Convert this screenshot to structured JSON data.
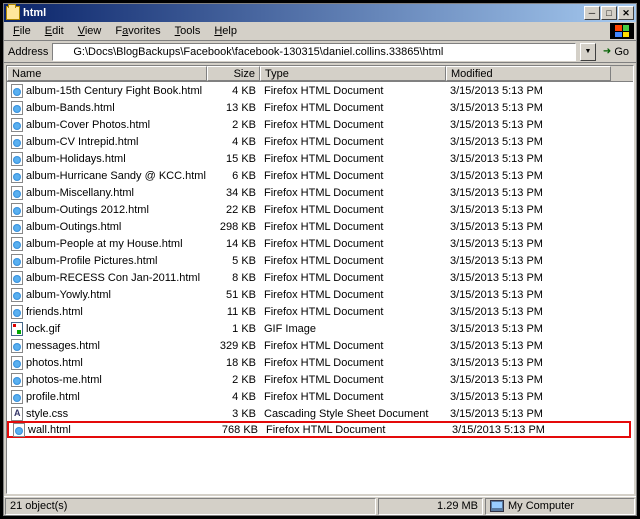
{
  "title": "html",
  "menu": {
    "file": "File",
    "edit": "Edit",
    "view": "View",
    "favorites": "Favorites",
    "tools": "Tools",
    "help": "Help"
  },
  "address": {
    "label": "Address",
    "path": "G:\\Docs\\BlogBackups\\Facebook\\facebook-130315\\daniel.collins.33865\\html",
    "go": "Go"
  },
  "columns": {
    "name": "Name",
    "size": "Size",
    "type": "Type",
    "modified": "Modified"
  },
  "files": [
    {
      "name": "album-15th Century Fight Book.html",
      "size": "4 KB",
      "type": "Firefox HTML Document",
      "modified": "3/15/2013 5:13 PM",
      "icon": "html"
    },
    {
      "name": "album-Bands.html",
      "size": "13 KB",
      "type": "Firefox HTML Document",
      "modified": "3/15/2013 5:13 PM",
      "icon": "html"
    },
    {
      "name": "album-Cover Photos.html",
      "size": "2 KB",
      "type": "Firefox HTML Document",
      "modified": "3/15/2013 5:13 PM",
      "icon": "html"
    },
    {
      "name": "album-CV Intrepid.html",
      "size": "4 KB",
      "type": "Firefox HTML Document",
      "modified": "3/15/2013 5:13 PM",
      "icon": "html"
    },
    {
      "name": "album-Holidays.html",
      "size": "15 KB",
      "type": "Firefox HTML Document",
      "modified": "3/15/2013 5:13 PM",
      "icon": "html"
    },
    {
      "name": "album-Hurricane Sandy @ KCC.html",
      "size": "6 KB",
      "type": "Firefox HTML Document",
      "modified": "3/15/2013 5:13 PM",
      "icon": "html"
    },
    {
      "name": "album-Miscellany.html",
      "size": "34 KB",
      "type": "Firefox HTML Document",
      "modified": "3/15/2013 5:13 PM",
      "icon": "html"
    },
    {
      "name": "album-Outings 2012.html",
      "size": "22 KB",
      "type": "Firefox HTML Document",
      "modified": "3/15/2013 5:13 PM",
      "icon": "html"
    },
    {
      "name": "album-Outings.html",
      "size": "298 KB",
      "type": "Firefox HTML Document",
      "modified": "3/15/2013 5:13 PM",
      "icon": "html"
    },
    {
      "name": "album-People at my House.html",
      "size": "14 KB",
      "type": "Firefox HTML Document",
      "modified": "3/15/2013 5:13 PM",
      "icon": "html"
    },
    {
      "name": "album-Profile Pictures.html",
      "size": "5 KB",
      "type": "Firefox HTML Document",
      "modified": "3/15/2013 5:13 PM",
      "icon": "html"
    },
    {
      "name": "album-RECESS Con Jan-2011.html",
      "size": "8 KB",
      "type": "Firefox HTML Document",
      "modified": "3/15/2013 5:13 PM",
      "icon": "html"
    },
    {
      "name": "album-Yowly.html",
      "size": "51 KB",
      "type": "Firefox HTML Document",
      "modified": "3/15/2013 5:13 PM",
      "icon": "html"
    },
    {
      "name": "friends.html",
      "size": "11 KB",
      "type": "Firefox HTML Document",
      "modified": "3/15/2013 5:13 PM",
      "icon": "html"
    },
    {
      "name": "lock.gif",
      "size": "1 KB",
      "type": "GIF Image",
      "modified": "3/15/2013 5:13 PM",
      "icon": "gif"
    },
    {
      "name": "messages.html",
      "size": "329 KB",
      "type": "Firefox HTML Document",
      "modified": "3/15/2013 5:13 PM",
      "icon": "html"
    },
    {
      "name": "photos.html",
      "size": "18 KB",
      "type": "Firefox HTML Document",
      "modified": "3/15/2013 5:13 PM",
      "icon": "html"
    },
    {
      "name": "photos-me.html",
      "size": "2 KB",
      "type": "Firefox HTML Document",
      "modified": "3/15/2013 5:13 PM",
      "icon": "html"
    },
    {
      "name": "profile.html",
      "size": "4 KB",
      "type": "Firefox HTML Document",
      "modified": "3/15/2013 5:13 PM",
      "icon": "html"
    },
    {
      "name": "style.css",
      "size": "3 KB",
      "type": "Cascading Style Sheet Document",
      "modified": "3/15/2013 5:13 PM",
      "icon": "css"
    },
    {
      "name": "wall.html",
      "size": "768 KB",
      "type": "Firefox HTML Document",
      "modified": "3/15/2013 5:13 PM",
      "icon": "html",
      "highlighted": true
    }
  ],
  "status": {
    "objects": "21 object(s)",
    "size": "1.29 MB",
    "location": "My Computer"
  }
}
